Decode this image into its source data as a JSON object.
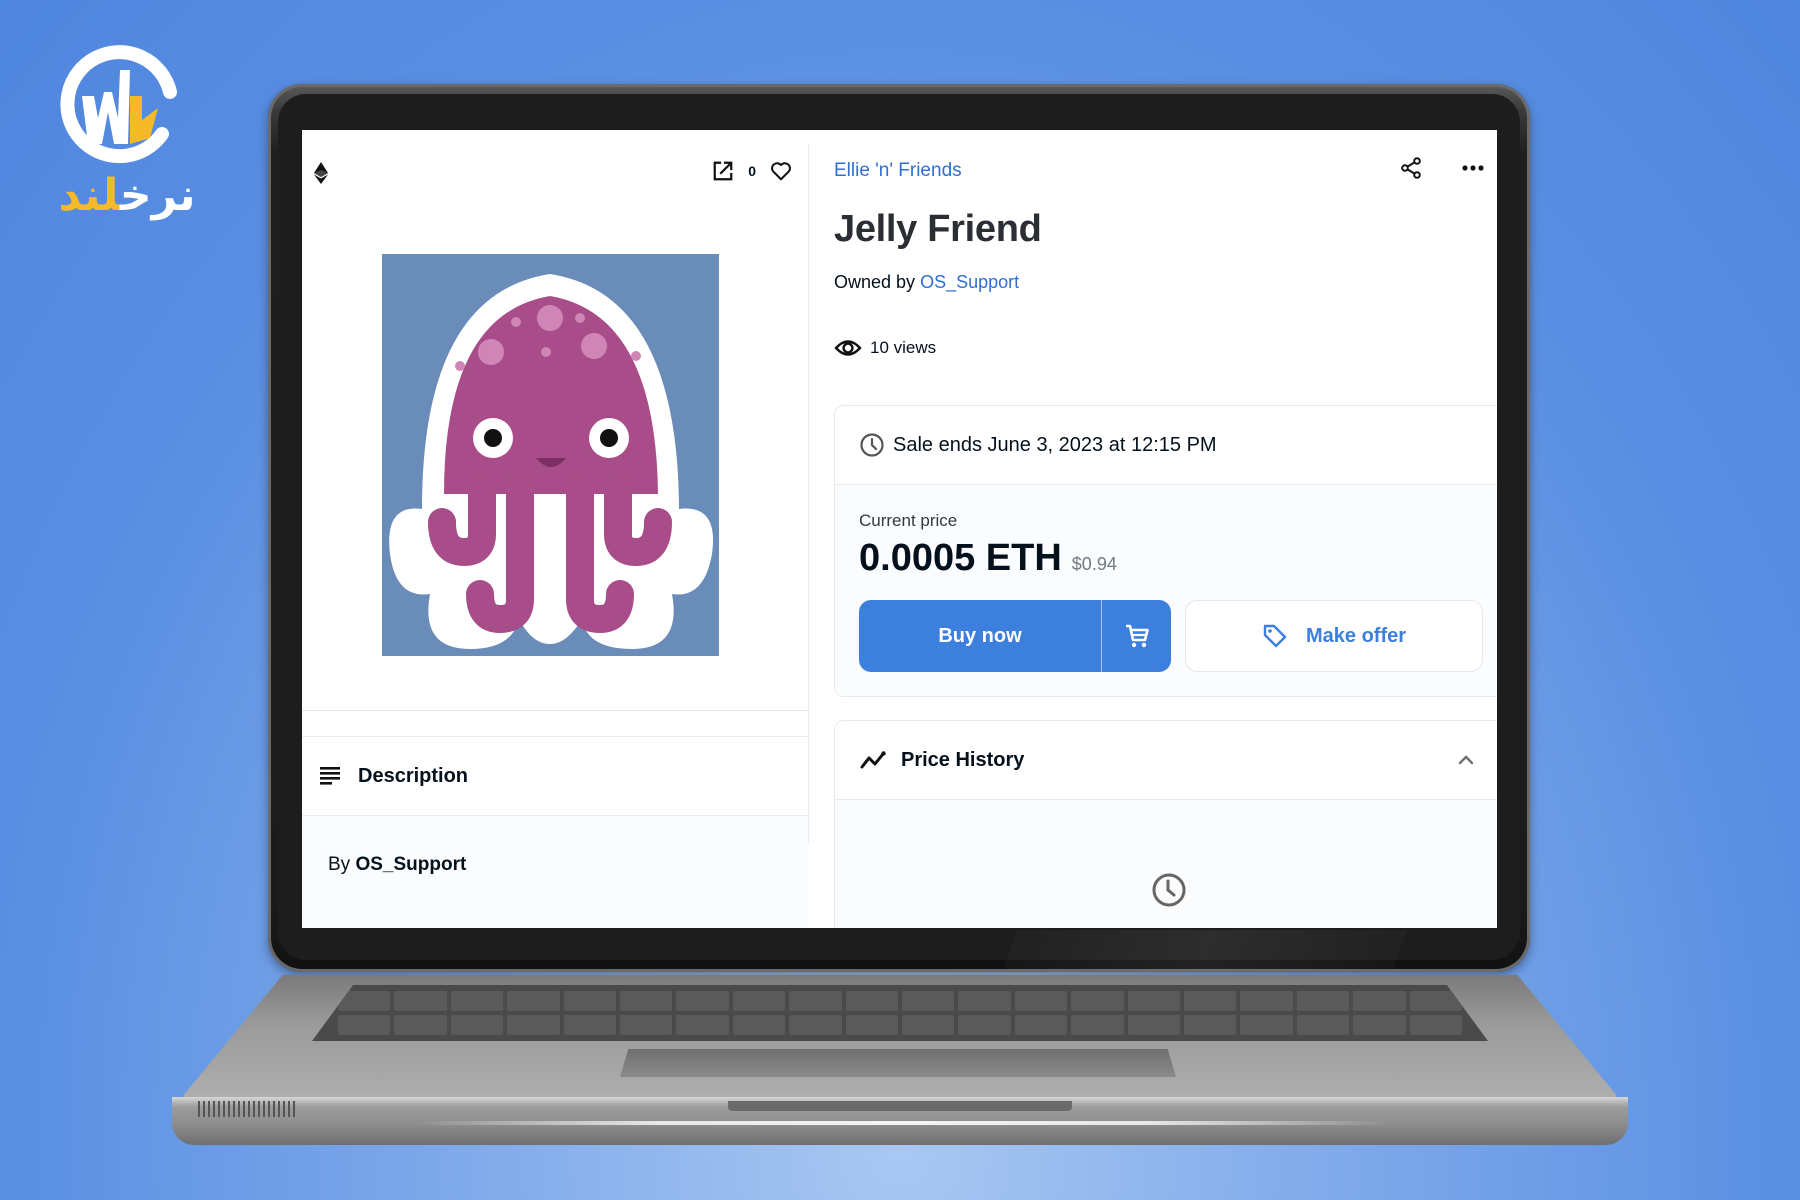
{
  "brand": {
    "logo_name": "Narkhland",
    "wordmark_white": "نرخ",
    "wordmark_yellow": "لند",
    "colors": {
      "white": "#ffffff",
      "yellow": "#f6b928"
    }
  },
  "media": {
    "chain_icon": "ethereum-icon",
    "favorite_count": "0",
    "icons": [
      "external-link-icon",
      "heart-icon"
    ],
    "artwork": "jellyfish-illustration"
  },
  "description": {
    "heading": "Description",
    "by_label": "By",
    "creator": "OS_Support"
  },
  "item": {
    "collection": "Ellie 'n' Friends",
    "title": "Jelly Friend",
    "owned_by_label": "Owned by",
    "owner": "OS_Support",
    "views": "10 views"
  },
  "sale": {
    "ends_text": "Sale ends June 3, 2023 at 12:15 PM",
    "current_price_label": "Current price",
    "price": "0.0005 ETH",
    "price_usd": "$0.94",
    "buy_label": "Buy now",
    "offer_label": "Make offer"
  },
  "price_history": {
    "heading": "Price History",
    "state": "expanded",
    "empty_icon": "clock-icon"
  },
  "colors": {
    "accent": "#3d7fdc",
    "link": "#2f6fd3",
    "text": "#04111d",
    "background": "#5a8fe2"
  }
}
